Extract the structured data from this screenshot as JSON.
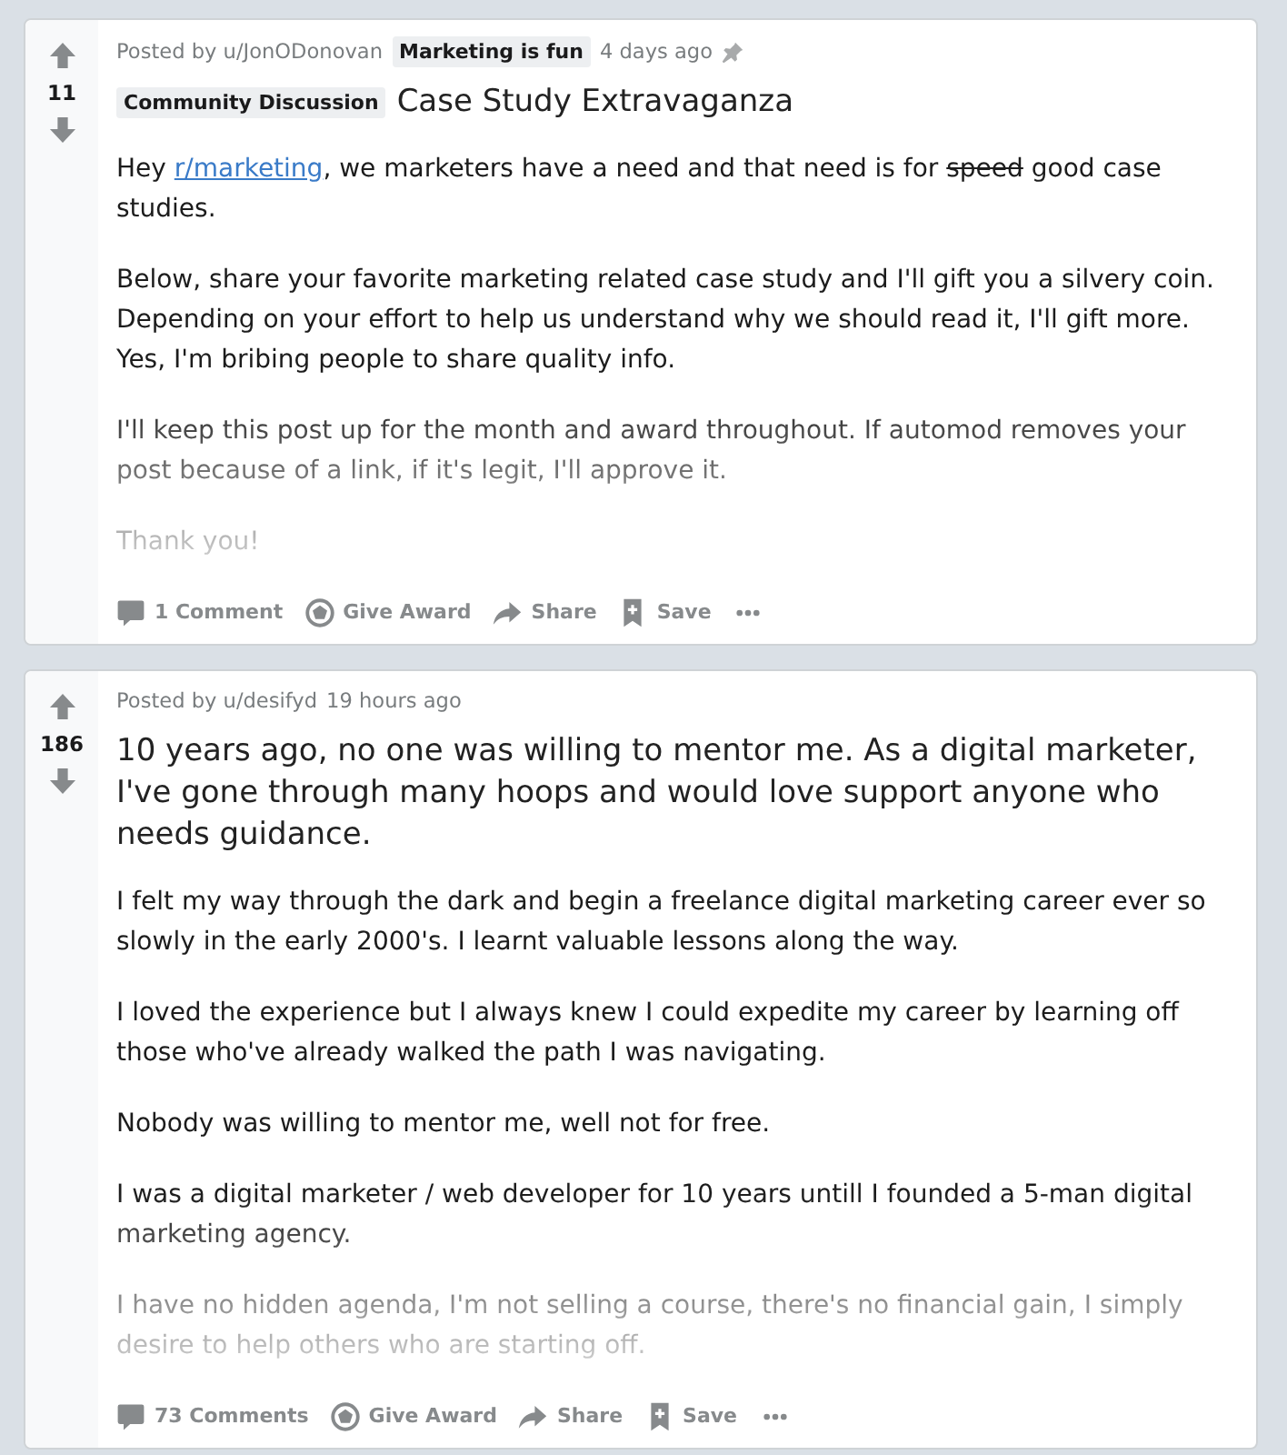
{
  "posts": [
    {
      "votes": "11",
      "posted_by": "Posted by u/JonODonovan",
      "user_flair": "Marketing is fun",
      "time": "4 days ago",
      "pinned": true,
      "post_flair": "Community Discussion",
      "title": "Case Study Extravaganza",
      "truncated": true,
      "body": [
        [
          {
            "kind": "text",
            "text": "Hey "
          },
          {
            "kind": "link",
            "text": "r/marketing"
          },
          {
            "kind": "text",
            "text": ", we marketers have a need and that need is for "
          },
          {
            "kind": "strike",
            "text": "speed"
          },
          {
            "kind": "text",
            "text": " good case studies."
          }
        ],
        "Below, share your favorite marketing related case study and I'll gift you a silvery coin. Depending on your effort to help us understand why we should read it, I'll gift more. Yes, I'm bribing people to share quality info.",
        "I'll keep this post up for the month and award throughout. If automod removes your post because of a link, if it's legit, I'll approve it.",
        "Thank you!"
      ],
      "actions": {
        "comments": "1 Comment",
        "award": "Give Award",
        "share": "Share",
        "save": "Save"
      }
    },
    {
      "votes": "186",
      "posted_by": "Posted by u/desifyd",
      "time": "19 hours ago",
      "pinned": false,
      "title": "10 years ago, no one was willing to mentor me. As a digital marketer, I've gone through many hoops and would love support anyone who needs guidance.",
      "truncated": true,
      "body": [
        "I felt my way through the dark and begin a freelance digital marketing career ever so slowly in the early 2000's. I learnt valuable lessons along the way.",
        "I loved the experience but I always knew I could expedite my career by learning off those who've already walked the path I was navigating.",
        "Nobody was willing to mentor me, well not for free.",
        "I was a digital marketer / web developer for 10 years untill I founded a 5-man digital marketing agency.",
        "I have no hidden agenda, I'm not selling a course, there's no financial gain, I simply desire to help others who are starting off."
      ],
      "actions": {
        "comments": "73 Comments",
        "award": "Give Award",
        "share": "Share",
        "save": "Save"
      }
    }
  ]
}
